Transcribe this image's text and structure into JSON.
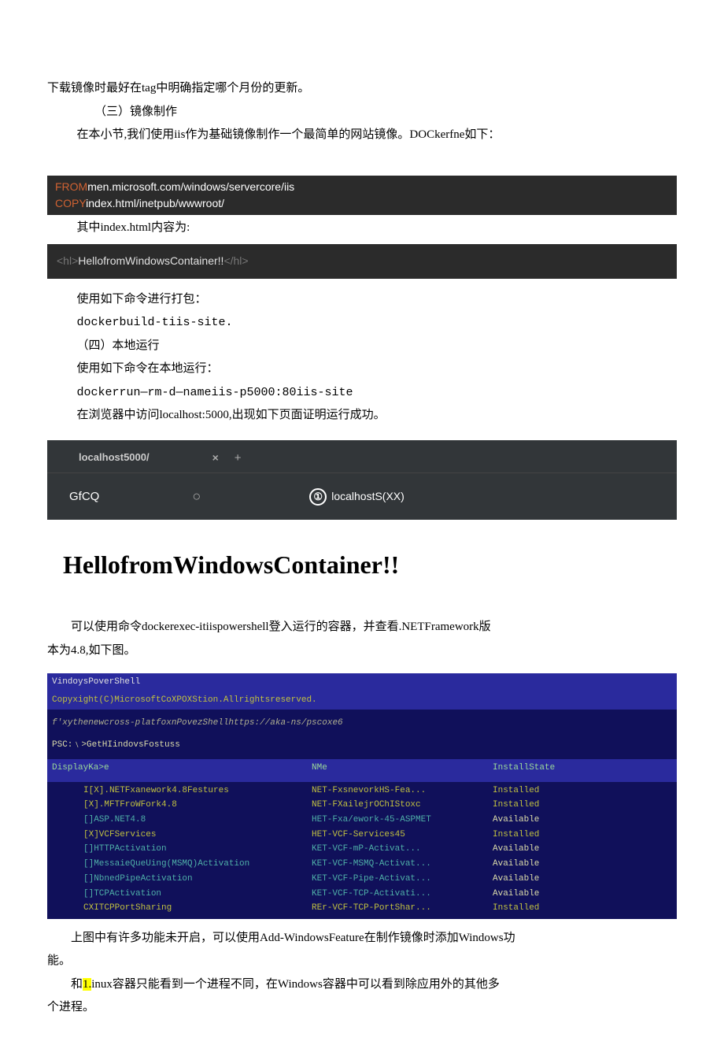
{
  "p1": "下载镜像时最好在tag中明确指定哪个月份的更新。",
  "h_3": "（三）镜像制作",
  "p2": "在本小节,我们使用iis作为基础镜像制作一个最简单的网站镜像。DOCkerfne如下：",
  "code1": {
    "k1": "FROM",
    "t1": "men.microsoft.com/windows/servercore/iis",
    "k2": "COPY",
    "t2": "index.html/inetpub/wwwroot/"
  },
  "p3": "其中index.html内容为:",
  "code2": {
    "open": "<hl>",
    "body": "HellofromWindowsContainer!!",
    "close": "</hl>"
  },
  "p4": "使用如下命令进行打包：",
  "p5": "dockerbuild-tiis-site.",
  "h_4": "（四）本地运行",
  "p6": "使用如下命令在本地运行：",
  "p7": "dockerrun—rm-d—nameiis-p5000:80iis-site",
  "p8": "在浏览器中访问localhost:5000,出现如下页面证明运行成功。",
  "browser": {
    "tab_title": "localhost5000/",
    "tab_close": "×",
    "tab_plus": "+",
    "nav": "GfCQ",
    "addr_icon": "①",
    "addr_text": "localhostS(XX)",
    "page_h1": "HellofromWindowsContainer!!"
  },
  "p9a": "可以使用命令dockerexec-itiispowershell登入运行的容器，并查看.NETFramework版",
  "p9b": "本为4.8,如下图。",
  "ps": {
    "l1": "VindoysPoverShell",
    "l2": "Copyxight(C)MicrosoftCoXPOXStion.Allrightsreserved.",
    "l3": "f'xythenewcross-platfoxnPovezShellhttps://aka-ns/pscoxe6",
    "l4": "PSC:﹨>GetHIindovsFostuss",
    "h_c1": "DisplayKa>e",
    "h_c2": "NMe",
    "h_c3": "InstallState",
    "rows": [
      {
        "c1": "I[X].NETFxanework4.8Festures",
        "c2": "NET-FxsnevorkHS-Fea...",
        "c3": "Installed",
        "cls": "yel",
        "st": "installed"
      },
      {
        "c1": "  [X].MFTFroWFork4.8",
        "c2": "NET-FXailejrOChIStoxc",
        "c3": "Installed",
        "cls": "yel",
        "st": "installed"
      },
      {
        "c1": "  []ASP.NET4.8",
        "c2": "HET-Fxa/ework-45-ASPMET",
        "c3": "Available",
        "cls": "teal",
        "st": "available"
      },
      {
        "c1": "  [X]VCFServices",
        "c2": "HET-VCF-Services45",
        "c3": "Installed",
        "cls": "yel",
        "st": "installed"
      },
      {
        "c1": "    []HTTPActivation",
        "c2": "KET-VCF-mP-Activat...",
        "c3": "Available",
        "cls": "teal",
        "st": "available"
      },
      {
        "c1": "    []MessaieQueUing(MSMQ)Activation",
        "c2": "KET-VCF-MSMQ-Activat...",
        "c3": "Available",
        "cls": "teal",
        "st": "available"
      },
      {
        "c1": "    []NbnedPipeActivation",
        "c2": "KET-VCF-Pipe-Activat...",
        "c3": "Available",
        "cls": "teal",
        "st": "available"
      },
      {
        "c1": "    []TCPActivation",
        "c2": "KET-VCF-TCP-Activati...",
        "c3": "Available",
        "cls": "teal",
        "st": "available"
      },
      {
        "c1": "    CXITCPPortSharing",
        "c2": "REr-VCF-TCP-PortShar...",
        "c3": "Installed",
        "cls": "yel",
        "st": "installed"
      }
    ]
  },
  "p10a": "上图中有许多功能未开启，可以使用Add-WindowsFeature在制作镜像时添加Windows功",
  "p10b": "能。",
  "p11a": "和",
  "p11hl": "1.",
  "p11b": "inux容器只能看到一个进程不同，在Windows容器中可以看到除应用外的其他多",
  "p11c": "个进程。"
}
